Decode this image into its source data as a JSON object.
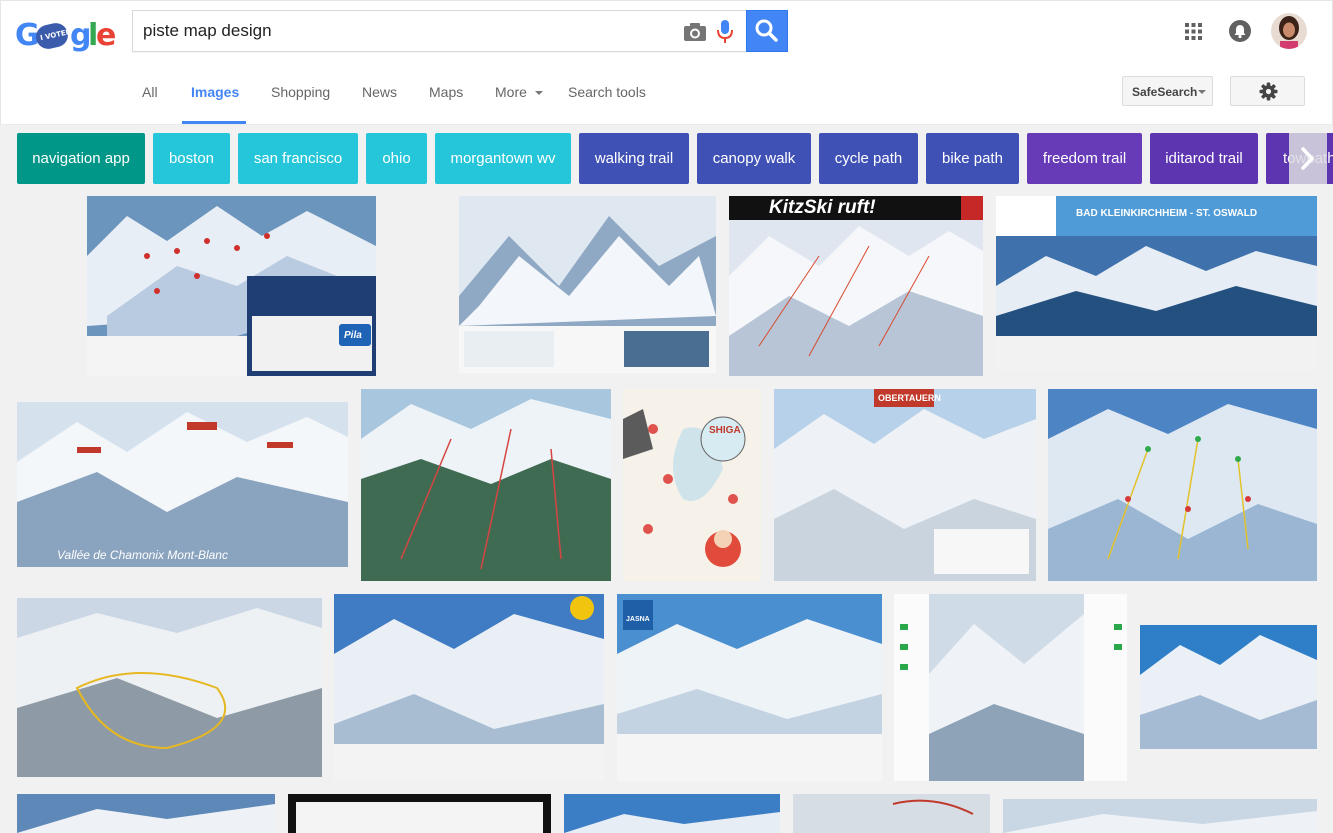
{
  "logo": {
    "letters": [
      "G",
      "I VOTED",
      "g",
      "l",
      "e"
    ]
  },
  "search": {
    "query": "piste map design"
  },
  "tabs": [
    {
      "label": "All"
    },
    {
      "label": "Images"
    },
    {
      "label": "Shopping"
    },
    {
      "label": "News"
    },
    {
      "label": "Maps"
    },
    {
      "label": "More"
    },
    {
      "label": "Search tools"
    }
  ],
  "controls": {
    "safesearch_label": "SafeSearch"
  },
  "chips": [
    {
      "label": "navigation app",
      "color": "#009688"
    },
    {
      "label": "boston",
      "color": "#26c6da"
    },
    {
      "label": "san francisco",
      "color": "#26c6da"
    },
    {
      "label": "ohio",
      "color": "#26c6da"
    },
    {
      "label": "morgantown wv",
      "color": "#26c6da"
    },
    {
      "label": "walking trail",
      "color": "#3f51b5"
    },
    {
      "label": "canopy walk",
      "color": "#3f51b5"
    },
    {
      "label": "cycle path",
      "color": "#3f51b5"
    },
    {
      "label": "bike path",
      "color": "#3f51b5"
    },
    {
      "label": "freedom trail",
      "color": "#673ab7"
    },
    {
      "label": "iditarod trail",
      "color": "#5e35b1"
    },
    {
      "label": "towpath",
      "color": "#5e35b1"
    }
  ],
  "image_text": {
    "kitzski": "KitzSki ruft!",
    "kleinkirchheim": "BAD KLEINKIRCHHEIM - ST. OSWALD",
    "chamonix": "Vallée de Chamonix Mont-Blanc",
    "obertauern": "OBERTAUERN",
    "shiga": "SHIGA",
    "jasna": "JASNA",
    "pila": "Pila"
  },
  "colors": {
    "accent": "#4285f4",
    "chip_teal": "#009688",
    "chip_cyan": "#26c6da",
    "chip_indigo": "#3f51b5",
    "chip_purple": "#673ab7"
  }
}
